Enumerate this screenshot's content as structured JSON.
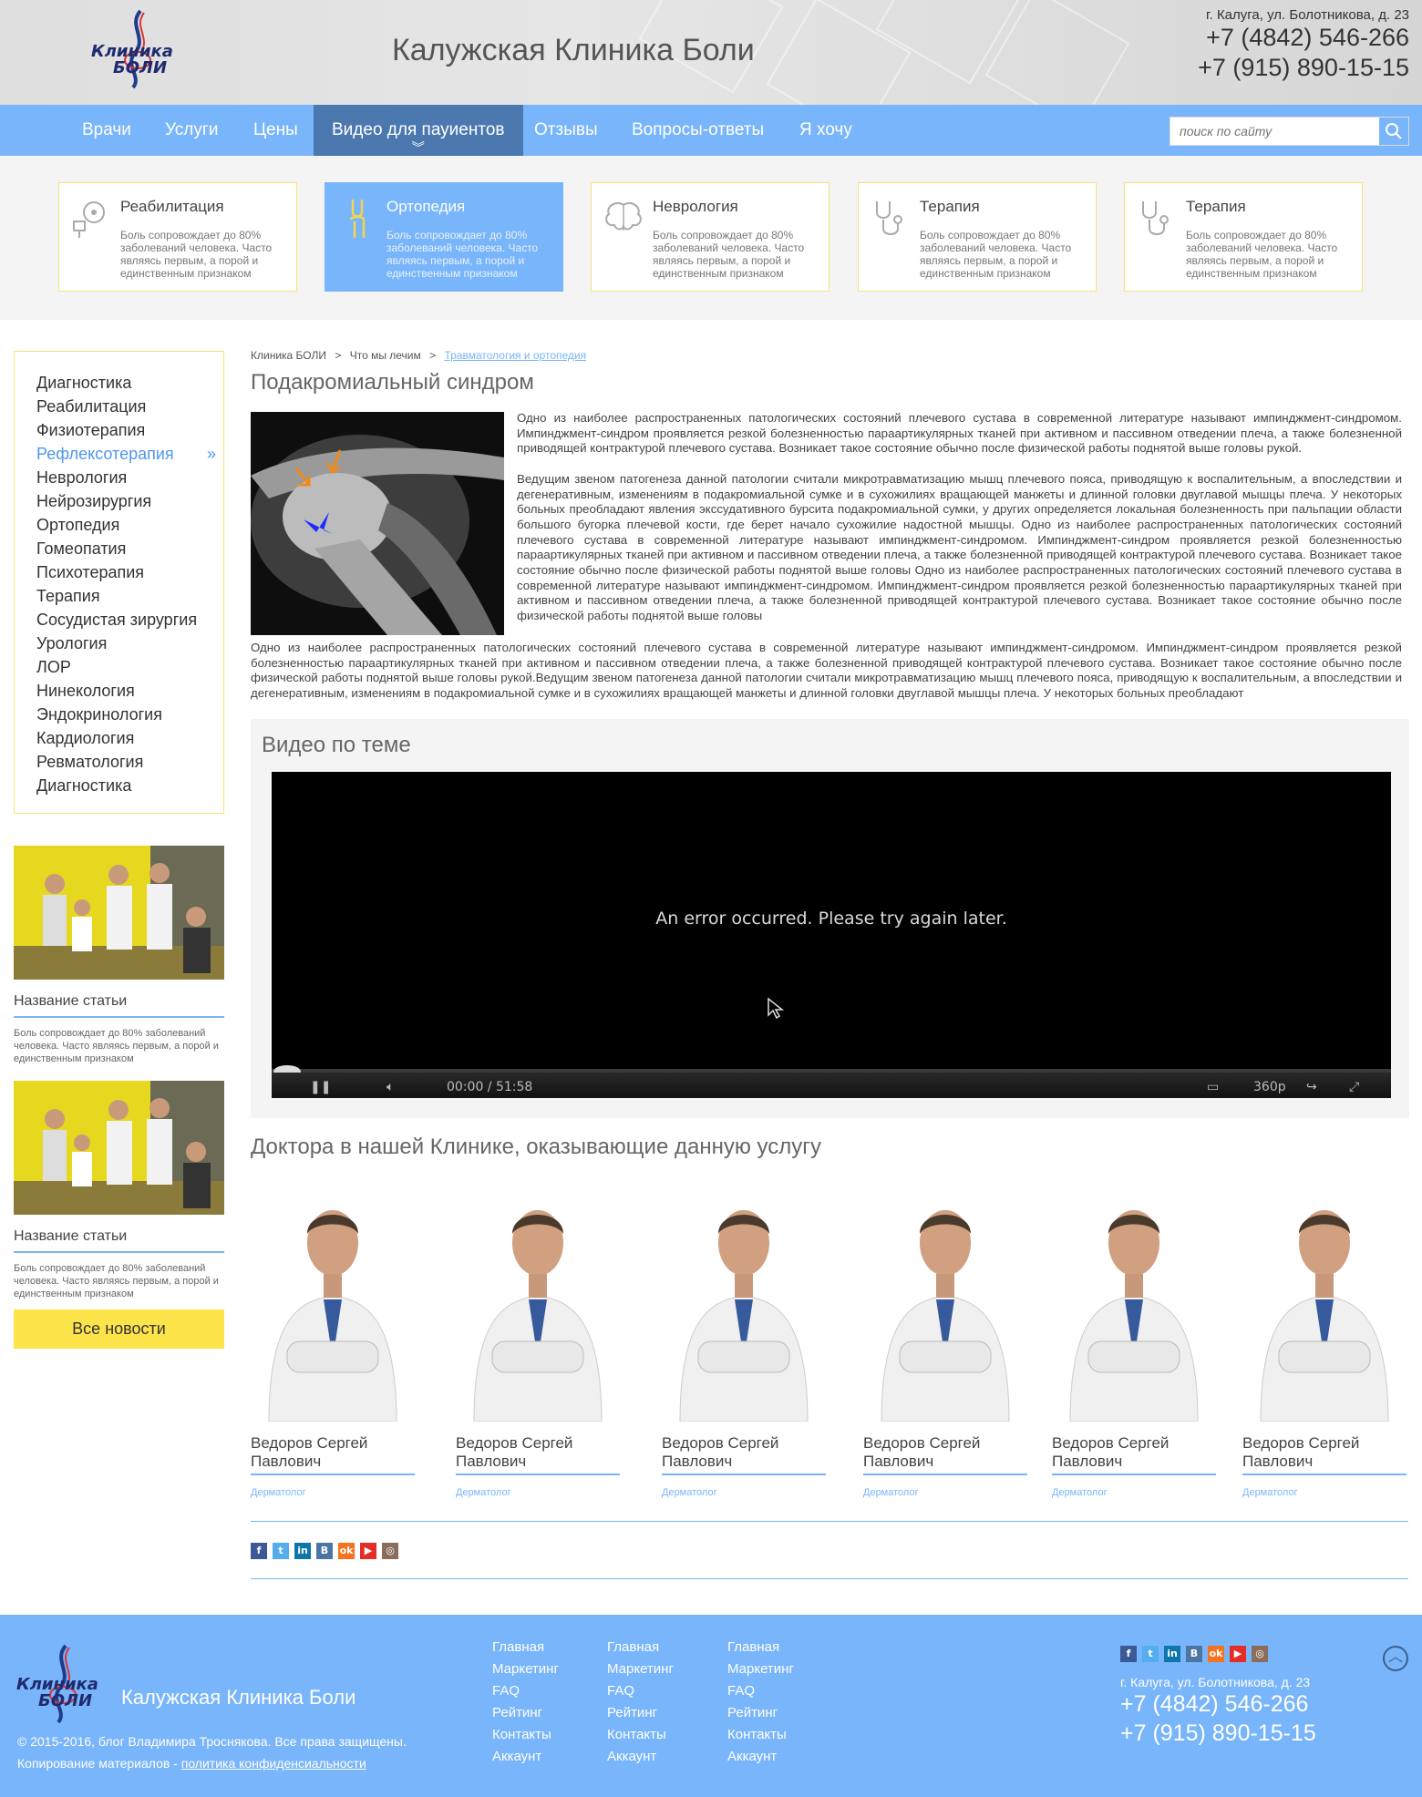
{
  "header": {
    "logo_line1": "Клиника",
    "logo_line2": "БОЛИ",
    "site_title": "Калужская Клиника Боли",
    "address": "г. Калуга, ул. Болотникова, д. 23",
    "phone1": "+7 (4842) 546-266",
    "phone2": "+7 (915) 890-15-15"
  },
  "nav": {
    "items": [
      "Врачи",
      "Услуги",
      "Цены",
      "Видео для пауиентов",
      "Отзывы",
      "Вопросы-ответы",
      "Я хочу"
    ],
    "active": "Видео для пауиентов",
    "search_placeholder": "поиск по сайту"
  },
  "cards": [
    {
      "title": "Реабилитация",
      "desc": "Боль сопровождает до 80% заболеваний человека. Часто являясь первым, а порой и единственным признаком",
      "icon": "blood-pressure-icon",
      "active": false
    },
    {
      "title": "Ортопедия",
      "desc": "Боль сопровождает до 80% заболеваний человека. Часто являясь первым, а порой и единственным признаком",
      "icon": "knee-joint-icon",
      "active": true
    },
    {
      "title": "Неврология",
      "desc": "Боль сопровождает до 80% заболеваний человека. Часто являясь первым, а порой и единственным признаком",
      "icon": "brain-icon",
      "active": false
    },
    {
      "title": "Терапия",
      "desc": "Боль сопровождает до 80% заболеваний человека. Часто являясь первым, а порой и единственным признаком",
      "icon": "stethoscope-icon",
      "active": false
    },
    {
      "title": "Терапия",
      "desc": "Боль сопровождает до 80% заболеваний человека. Часто являясь первым, а порой и единственным признаком",
      "icon": "stethoscope-icon",
      "active": false
    }
  ],
  "sidebar": {
    "menu": [
      "Диагностика",
      "Реабилитация",
      "Физиотерапия",
      "Рефлексотерапия",
      "Неврология",
      "Нейрозирургия",
      "Ортопедия",
      "Гомеопатия",
      "Психотерапия",
      "Терапия",
      "Сосудистая зирургия",
      "Урология",
      "ЛОР",
      "Нинекология",
      "Эндокринология",
      "Кардиология",
      "Ревматология",
      "Диагностика"
    ],
    "active_item": "Рефлексотерапия",
    "active_marker": "»",
    "articles": [
      {
        "title": "Название статьи",
        "desc": "Боль сопровождает до 80% заболеваний человека. Часто являясь первым, а порой и единственным признаком"
      },
      {
        "title": "Название статьи",
        "desc": "Боль сопровождает до 80% заболеваний человека. Часто являясь первым, а порой и единственным признаком"
      }
    ],
    "all_news": "Все новости"
  },
  "main": {
    "breadcrumbs": [
      "Клиника БОЛИ",
      "Что мы лечим",
      "Травматология и ортопедия"
    ],
    "breadcrumb_sep": ">",
    "title": "Подакромиальный синдром",
    "para1": "Одно из наиболее распространенных патологических состояний плечевого сустава в современной литературе называют импинджмент-синдромом. Импинджмент-синдром проявляется резкой болезненностью параартикулярных тканей при активном и пассивном  отведении плеча, а также болезненной приводящей контрактурой плечевого сустава. Возникает такое состояние обычно после физической работы поднятой выше головы рукой.",
    "para2": "Ведущим звеном патогенеза данной патологии считали микротравматизацию мышц плечевого пояса, приводящую к воспалительным, а впоследствии и дегенеративным, изменениям в подакромиальной сумке и в сухожилиях вращающей манжеты и длинной головки двуглавой мышцы плеча. У некоторых больных преобладают явления экссудативного бурсита подакромиальной сумки, у других определяется локальная болезненность при пальпации области большого бугорка плечевой кости, где берет начало сухожилие надостной мышцы. Одно из наиболее распространенных патологических состояний плечевого сустава в современной литературе называют импинджмент-синдромом. Импинджмент-синдром проявляется резкой болезненностью параартикулярных тканей при активном и пассивном  отведении плеча, а также болезненной приводящей контрактурой плечевого сустава. Возникает такое состояние обычно после физической работы поднятой выше головы Одно из наиболее распространенных патологических состояний плечевого сустава в современной литературе называют импинджмент-синдромом. Импинджмент-синдром проявляется резкой болезненностью параартикулярных тканей при активном и пассивном  отведении плеча, а также болезненной приводящей контрактурой плечевого сустава. Возникает такое состояние обычно после физической работы поднятой выше головы",
    "para3": "Одно из наиболее распространенных патологических состояний плечевого сустава в современной литературе называют импинджмент-синдромом. Импинджмент-синдром проявляется резкой болезненностью параартикулярных тканей при активном и пассивном  отведении плеча, а также болезненной приводящей контрактурой плечевого сустава. Возникает такое состояние обычно после физической работы поднятой выше головы рукой.Ведущим звеном патогенеза данной патологии считали микротравматизацию мышц плечевого пояса, приводящую к воспалительным, а впоследствии и дегенеративным, изменениям в подакромиальной сумке и в сухожилиях вращающей манжеты и длинной головки двуглавой мышцы плеча. У некоторых больных преобладают",
    "video_title": "Видео по теме",
    "video_error": "An error occurred. Please try again later.",
    "video_time": "00:00 / 51:58",
    "video_quality": "360p",
    "doctors_title": "Доктора в нашей Клинике, оказывающие данную услугу",
    "doctors": [
      {
        "name": "Ведоров Сергей Павлович",
        "role": "Дерматолог"
      },
      {
        "name": "Ведоров Сергей Павлович",
        "role": "Дерматолог"
      },
      {
        "name": "Ведоров Сергей Павлович",
        "role": "Дерматолог"
      },
      {
        "name": "Ведоров Сергей Павлович",
        "role": "Дерматолог"
      },
      {
        "name": "Ведоров Сергей Павлович",
        "role": "Дерматолог"
      },
      {
        "name": "Ведоров Сергей Павлович",
        "role": "Дерматолог"
      }
    ]
  },
  "socials": [
    {
      "name": "facebook-icon",
      "glyph": "f",
      "color": "#3b5998"
    },
    {
      "name": "twitter-icon",
      "glyph": "t",
      "color": "#55acee"
    },
    {
      "name": "linkedin-icon",
      "glyph": "in",
      "color": "#0e76a8"
    },
    {
      "name": "vk-icon",
      "glyph": "B",
      "color": "#4c75a3"
    },
    {
      "name": "odnoklassniki-icon",
      "glyph": "ok",
      "color": "#f4731c"
    },
    {
      "name": "youtube-icon",
      "glyph": "▶",
      "color": "#e52d27"
    },
    {
      "name": "instagram-icon",
      "glyph": "◎",
      "color": "#8a6d5a"
    }
  ],
  "footer": {
    "title": "Калужская Клиника Боли",
    "copyright": "© 2015-2016, блог Владимира Тросняковa. Все права защищены.",
    "copy_note": "Копирование материалов - ",
    "policy_link": "политика конфиденсиальности",
    "col1": [
      "Главная",
      "Маркетинг",
      "FAQ",
      "Рейтинг",
      "Контакты",
      "Аккаунт"
    ],
    "col2": [
      "Главная",
      "Маркетинг",
      "FAQ",
      "Рейтинг",
      "Контакты",
      "Аккаунт"
    ],
    "col3": [
      "Главная",
      "Маркетинг",
      "FAQ",
      "Рейтинг",
      "Контакты",
      "Аккаунт"
    ],
    "address": "г. Калуга, ул. Болотникова, д. 23",
    "phone1": "+7 (4842) 546-266",
    "phone2": "+7 (915) 890-15-15"
  },
  "colors": {
    "accent_blue": "#79b5fa",
    "nav_active": "#4c78b0",
    "yellow": "#fde44a",
    "card_border": "#f7e27e"
  }
}
